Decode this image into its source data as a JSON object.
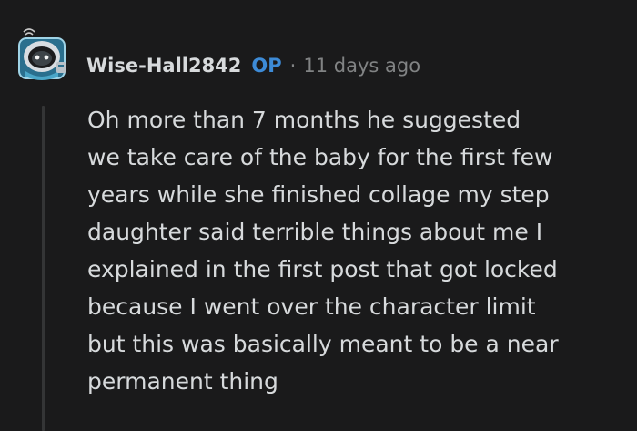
{
  "comment": {
    "author": "Wise-Hall2842",
    "op_badge": "OP",
    "separator": "·",
    "age": "11 days ago",
    "body_lines": [
      "Oh more than 7 months he suggested",
      "we take care of the baby for the first few",
      "years while she finished collage my step",
      "daughter said terrible things about me I",
      "explained in the first post that got locked",
      "because I went over the character limit",
      "but this was basically meant to be a near",
      "permanent thing"
    ]
  },
  "colors": {
    "background": "#1a1a1b",
    "text": "#d7dadc",
    "muted": "#818384",
    "op_blue": "#3d8bd7",
    "thread_line": "#343536"
  },
  "icons": {
    "avatar": "snoo-avatar-icon"
  }
}
